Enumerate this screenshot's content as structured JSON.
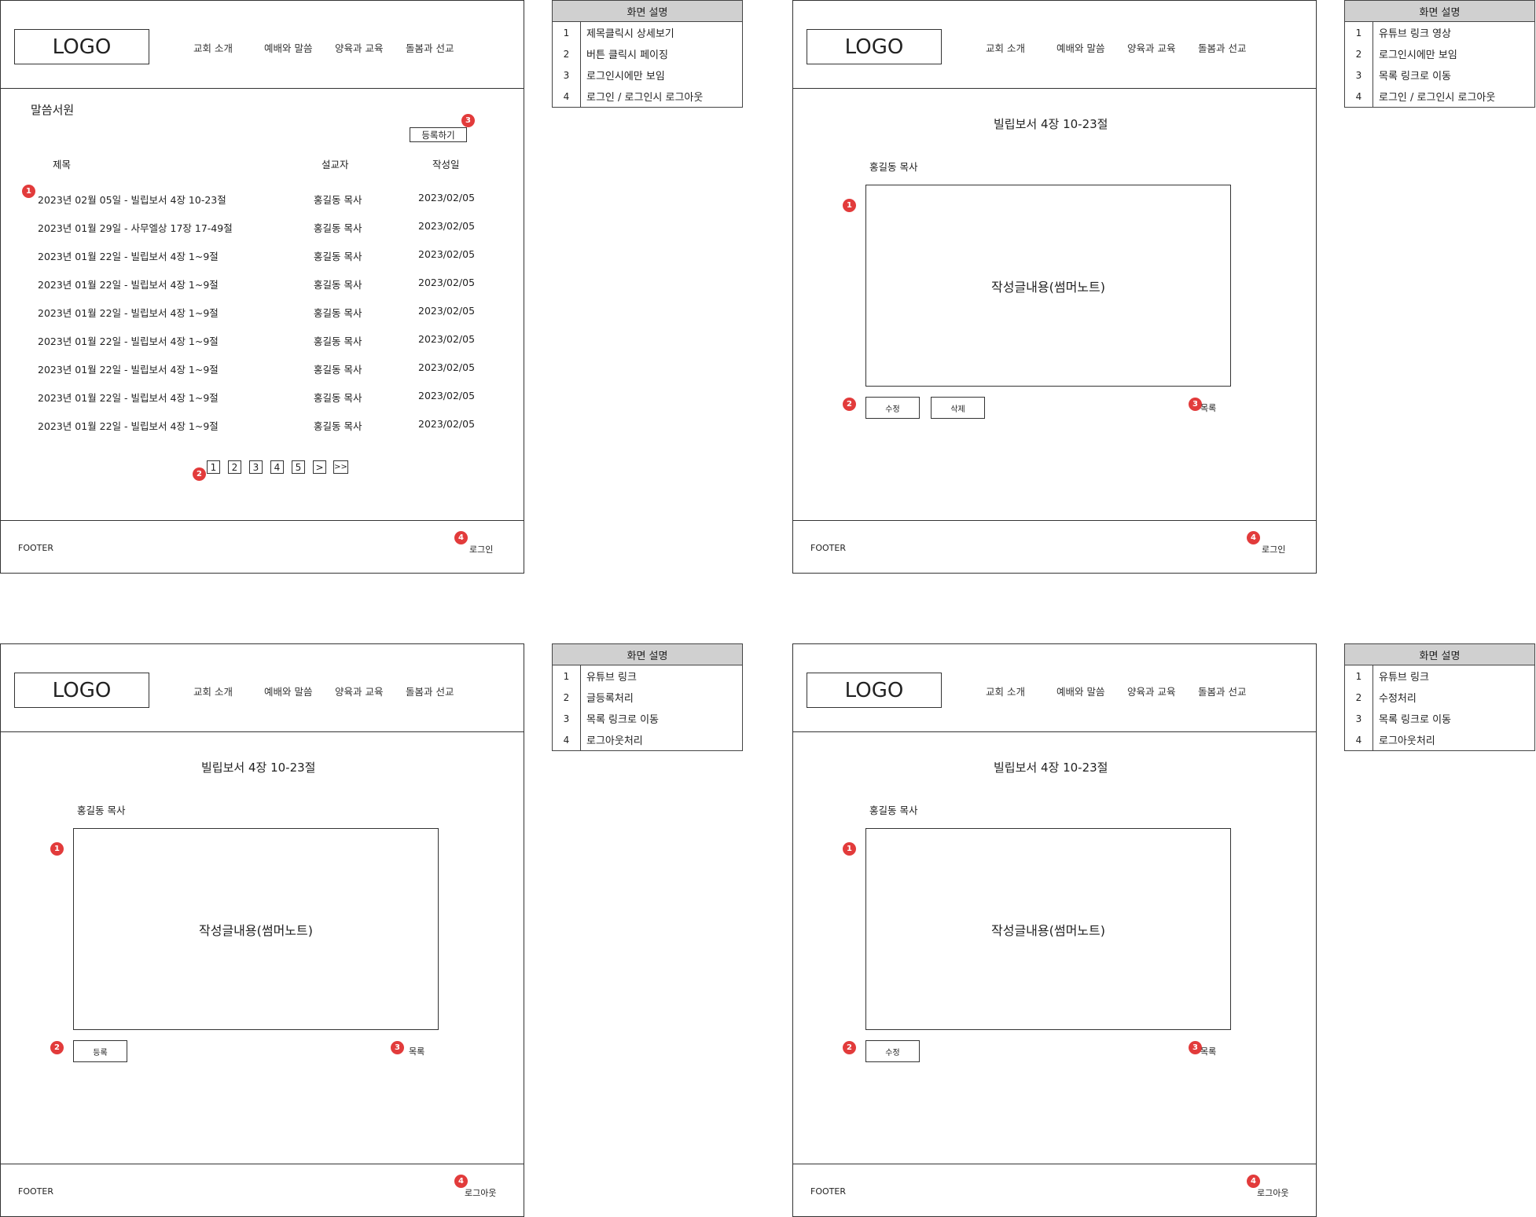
{
  "common": {
    "logo": "LOGO",
    "nav": [
      "교회 소개",
      "예배와 말씀",
      "양육과 교육",
      "돌봄과 선교"
    ],
    "footer": "FOOTER"
  },
  "s1": {
    "section_title": "말씀서원",
    "register_button": "등록하기",
    "columns": [
      "제목",
      "설교자",
      "작성일"
    ],
    "rows": [
      {
        "title": "2023년 02월 05일 - 빌립보서 4장 10-23절",
        "preacher": "홍길동 목사",
        "date": "2023/02/05"
      },
      {
        "title": "2023년 01월 29일 - 사무엘상 17장 17-49절",
        "preacher": "홍길동 목사",
        "date": "2023/02/05"
      },
      {
        "title": "2023년 01월 22일 - 빌립보서 4장 1~9절",
        "preacher": "홍길동 목사",
        "date": "2023/02/05"
      },
      {
        "title": "2023년 01월 22일 - 빌립보서 4장 1~9절",
        "preacher": "홍길동 목사",
        "date": "2023/02/05"
      },
      {
        "title": "2023년 01월 22일 - 빌립보서 4장 1~9절",
        "preacher": "홍길동 목사",
        "date": "2023/02/05"
      },
      {
        "title": "2023년 01월 22일 - 빌립보서 4장 1~9절",
        "preacher": "홍길동 목사",
        "date": "2023/02/05"
      },
      {
        "title": "2023년 01월 22일 - 빌립보서 4장 1~9절",
        "preacher": "홍길동 목사",
        "date": "2023/02/05"
      },
      {
        "title": "2023년 01월 22일 - 빌립보서 4장 1~9절",
        "preacher": "홍길동 목사",
        "date": "2023/02/05"
      },
      {
        "title": "2023년 01월 22일 - 빌립보서 4장 1~9절",
        "preacher": "홍길동 목사",
        "date": "2023/02/05"
      }
    ],
    "pages": [
      "1",
      "2",
      "3",
      "4",
      "5",
      ">",
      ">>"
    ],
    "footer_link": "로그인",
    "badges": [
      "1",
      "2",
      "3",
      "4"
    ]
  },
  "s2": {
    "post_title": "빌립보서 4장 10-23절",
    "author": "홍길동 목사",
    "content": "작성글내용(썸머노트)",
    "edit_button": "수정",
    "delete_button": "삭제",
    "list_link": "목록",
    "footer_link": "로그인",
    "badges": [
      "1",
      "2",
      "3",
      "4"
    ]
  },
  "s3": {
    "post_title": "빌립보서 4장 10-23절",
    "author": "홍길동 목사",
    "content": "작성글내용(썸머노트)",
    "register_button": "등록",
    "list_link": "목록",
    "footer_link": "로그아웃",
    "badges": [
      "1",
      "2",
      "3",
      "4"
    ]
  },
  "s4": {
    "post_title": "빌립보서 4장 10-23절",
    "author": "홍길동 목사",
    "content": "작성글내용(썸머노트)",
    "edit_button": "수정",
    "list_link": "목록",
    "footer_link": "로그아웃",
    "badges": [
      "1",
      "2",
      "3",
      "4"
    ]
  },
  "desc1": {
    "header": "화면 설명",
    "rows": [
      {
        "num": "1",
        "text": "제목클릭시 상세보기"
      },
      {
        "num": "2",
        "text": "버튼 클릭시 페이징"
      },
      {
        "num": "3",
        "text": "로그인시에만 보임"
      },
      {
        "num": "4",
        "text": "로그인 / 로그인시 로그아웃"
      }
    ]
  },
  "desc2": {
    "header": "화면 설명",
    "rows": [
      {
        "num": "1",
        "text": "유튜브 링크 영상"
      },
      {
        "num": "2",
        "text": "로그인시에만 보임"
      },
      {
        "num": "3",
        "text": "목록 링크로 이동"
      },
      {
        "num": "4",
        "text": "로그인 / 로그인시 로그아웃"
      }
    ]
  },
  "desc3": {
    "header": "화면 설명",
    "rows": [
      {
        "num": "1",
        "text": "유튜브 링크"
      },
      {
        "num": "2",
        "text": "글등록처리"
      },
      {
        "num": "3",
        "text": "목록 링크로 이동"
      },
      {
        "num": "4",
        "text": "로그아웃처리"
      }
    ]
  },
  "desc4": {
    "header": "화면 설명",
    "rows": [
      {
        "num": "1",
        "text": "유튜브 링크"
      },
      {
        "num": "2",
        "text": "수정처리"
      },
      {
        "num": "3",
        "text": "목록 링크로 이동"
      },
      {
        "num": "4",
        "text": "로그아웃처리"
      }
    ]
  }
}
